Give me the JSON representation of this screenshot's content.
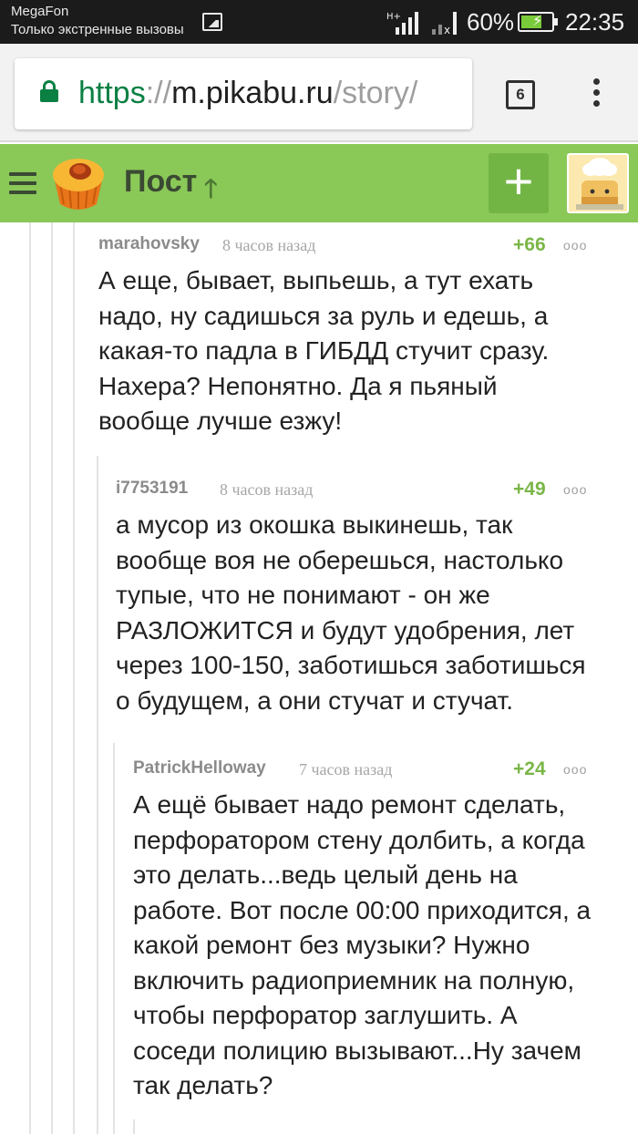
{
  "status_bar": {
    "carrier": "MegaFon",
    "network_status": "Только экстренные вызовы",
    "network_type": "H+",
    "battery_percent": "60%",
    "time": "22:35"
  },
  "browser": {
    "url_scheme": "https",
    "url_separator": "://",
    "url_host": "m.pikabu.ru",
    "url_path": "/story/",
    "tab_count": "6",
    "accent_color": "#0b8043"
  },
  "header": {
    "title": "Пост",
    "add_label": "+",
    "background_color": "#8ac858"
  },
  "comments": [
    {
      "author": "marahovsky",
      "time": "8 часов назад",
      "rating": "+66",
      "menu": "ooo",
      "text": "А еще, бывает, выпьешь, а тут ехать\nнадо, ну садишься за руль и едешь, а\nкакая-то падла в ГИБДД стучит сразу.\nНахера? Непонятно. Да я пьяный\nвообще лучше езжу!"
    },
    {
      "author": "i7753191",
      "time": "8 часов назад",
      "rating": "+49",
      "menu": "ooo",
      "text": "а мусор из окошка выкинешь, так\nвообще воя не оберешься, настолько\nтупые, что не понимают - он же\nРАЗЛОЖИТСЯ и будут удобрения, лет\nчерез 100-150, заботишься заботишься\nо будущем, а они стучат и стучат."
    },
    {
      "author": "PatrickHelloway",
      "time": "7 часов назад",
      "rating": "+24",
      "menu": "ooo",
      "text": "А ещё бывает надо ремонт сделать,\nперфоратором стену долбить, а когда\nэто делать...ведь целый день на\nработе. Вот после 00:00 приходится, а\nкакой ремонт без музыки? Нужно\nвключить радиоприемник на полную,\nчтобы перфоратор заглушить. А\nсоседи полицию вызывают...Ну зачем\nтак делать?"
    }
  ]
}
